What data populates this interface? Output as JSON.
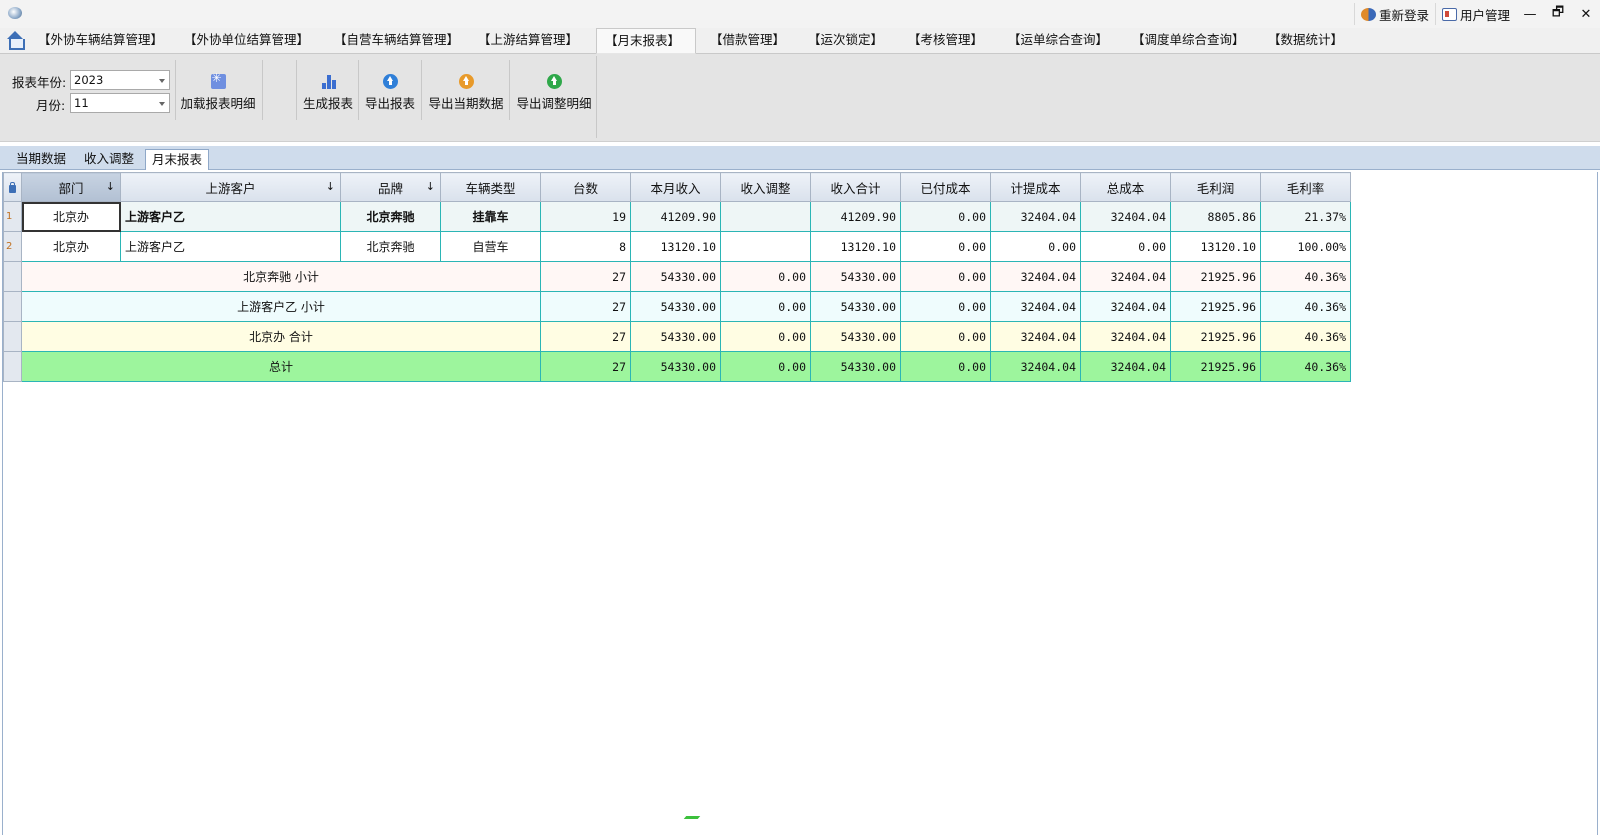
{
  "titlebar": {
    "relogin_label": "重新登录",
    "usermgr_label": "用户管理",
    "minimize_glyph": "—",
    "restore_glyph": "🗗",
    "close_glyph": "✕"
  },
  "menu": {
    "tabs": [
      {
        "label": "【外协车辆结算管理】"
      },
      {
        "label": "【外协单位结算管理】"
      },
      {
        "label": "【自营车辆结算管理】"
      },
      {
        "label": "【上游结算管理】"
      },
      {
        "label": "【月末报表】"
      },
      {
        "label": "【借款管理】"
      },
      {
        "label": "【运次锁定】"
      },
      {
        "label": "【考核管理】"
      },
      {
        "label": "【运单综合查询】"
      },
      {
        "label": "【调度单综合查询】"
      },
      {
        "label": "【数据统计】"
      }
    ],
    "active_index": 4
  },
  "ribbon": {
    "year_label": "报表年份:",
    "year_value": "2023",
    "month_label": "月份:",
    "month_value": "11",
    "load_details": "加载报表明细",
    "generate": "生成报表",
    "export_report": "导出报表",
    "export_current": "导出当期数据",
    "export_adjust": "导出调整明细"
  },
  "subtabs": {
    "items": [
      {
        "label": "当期数据"
      },
      {
        "label": "收入调整"
      },
      {
        "label": "月末报表"
      }
    ],
    "active_index": 2
  },
  "grid": {
    "headers": {
      "dept": "部门",
      "customer": "上游客户",
      "brand": "品牌",
      "vehicle_type": "车辆类型",
      "count": "台数",
      "month_income": "本月收入",
      "income_adjust": "收入调整",
      "income_total": "收入合计",
      "paid_cost": "已付成本",
      "accrued_cost": "计提成本",
      "total_cost": "总成本",
      "gross_profit": "毛利润",
      "gross_margin": "毛利率"
    },
    "sort_glyph": "↓",
    "rows": [
      {
        "num": "1",
        "dept": "北京办",
        "customer": "上游客户乙",
        "brand": "北京奔驰",
        "vehicle_type": "挂靠车",
        "count": "19",
        "month_income": "41209.90",
        "income_adjust": "",
        "income_total": "41209.90",
        "paid_cost": "0.00",
        "accrued_cost": "32404.04",
        "total_cost": "32404.04",
        "gross_profit": "8805.86",
        "gross_margin": "21.37%"
      },
      {
        "num": "2",
        "dept": "北京办",
        "customer": "上游客户乙",
        "brand": "北京奔驰",
        "vehicle_type": "自营车",
        "count": "8",
        "month_income": "13120.10",
        "income_adjust": "",
        "income_total": "13120.10",
        "paid_cost": "0.00",
        "accrued_cost": "0.00",
        "total_cost": "0.00",
        "gross_profit": "13120.10",
        "gross_margin": "100.00%"
      }
    ],
    "summaries": [
      {
        "label": "北京奔驰  小计",
        "count": "27",
        "month_income": "54330.00",
        "income_adjust": "0.00",
        "income_total": "54330.00",
        "paid_cost": "0.00",
        "accrued_cost": "32404.04",
        "total_cost": "32404.04",
        "gross_profit": "21925.96",
        "gross_margin": "40.36%"
      },
      {
        "label": "上游客户乙  小计",
        "count": "27",
        "month_income": "54330.00",
        "income_adjust": "0.00",
        "income_total": "54330.00",
        "paid_cost": "0.00",
        "accrued_cost": "32404.04",
        "total_cost": "32404.04",
        "gross_profit": "21925.96",
        "gross_margin": "40.36%"
      },
      {
        "label": "北京办  合计",
        "count": "27",
        "month_income": "54330.00",
        "income_adjust": "0.00",
        "income_total": "54330.00",
        "paid_cost": "0.00",
        "accrued_cost": "32404.04",
        "total_cost": "32404.04",
        "gross_profit": "21925.96",
        "gross_margin": "40.36%"
      },
      {
        "label": "总计",
        "count": "27",
        "month_income": "54330.00",
        "income_adjust": "0.00",
        "income_total": "54330.00",
        "paid_cost": "0.00",
        "accrued_cost": "32404.04",
        "total_cost": "32404.04",
        "gross_profit": "21925.96",
        "gross_margin": "40.36%"
      }
    ]
  },
  "colors": {
    "total_row": "#9df59d",
    "dept_row": "#fffde3",
    "customer_row": "#effcfd",
    "brand_row": "#fff7f5",
    "grid_line": "#2bb5b5"
  },
  "icons": {
    "home": "home-icon",
    "relogin": "relogin-icon",
    "usermgr": "user-card-icon",
    "load": "load-icon",
    "generate": "bar-chart-icon",
    "export": "upload-circle-icon",
    "lock": "lock-icon"
  }
}
